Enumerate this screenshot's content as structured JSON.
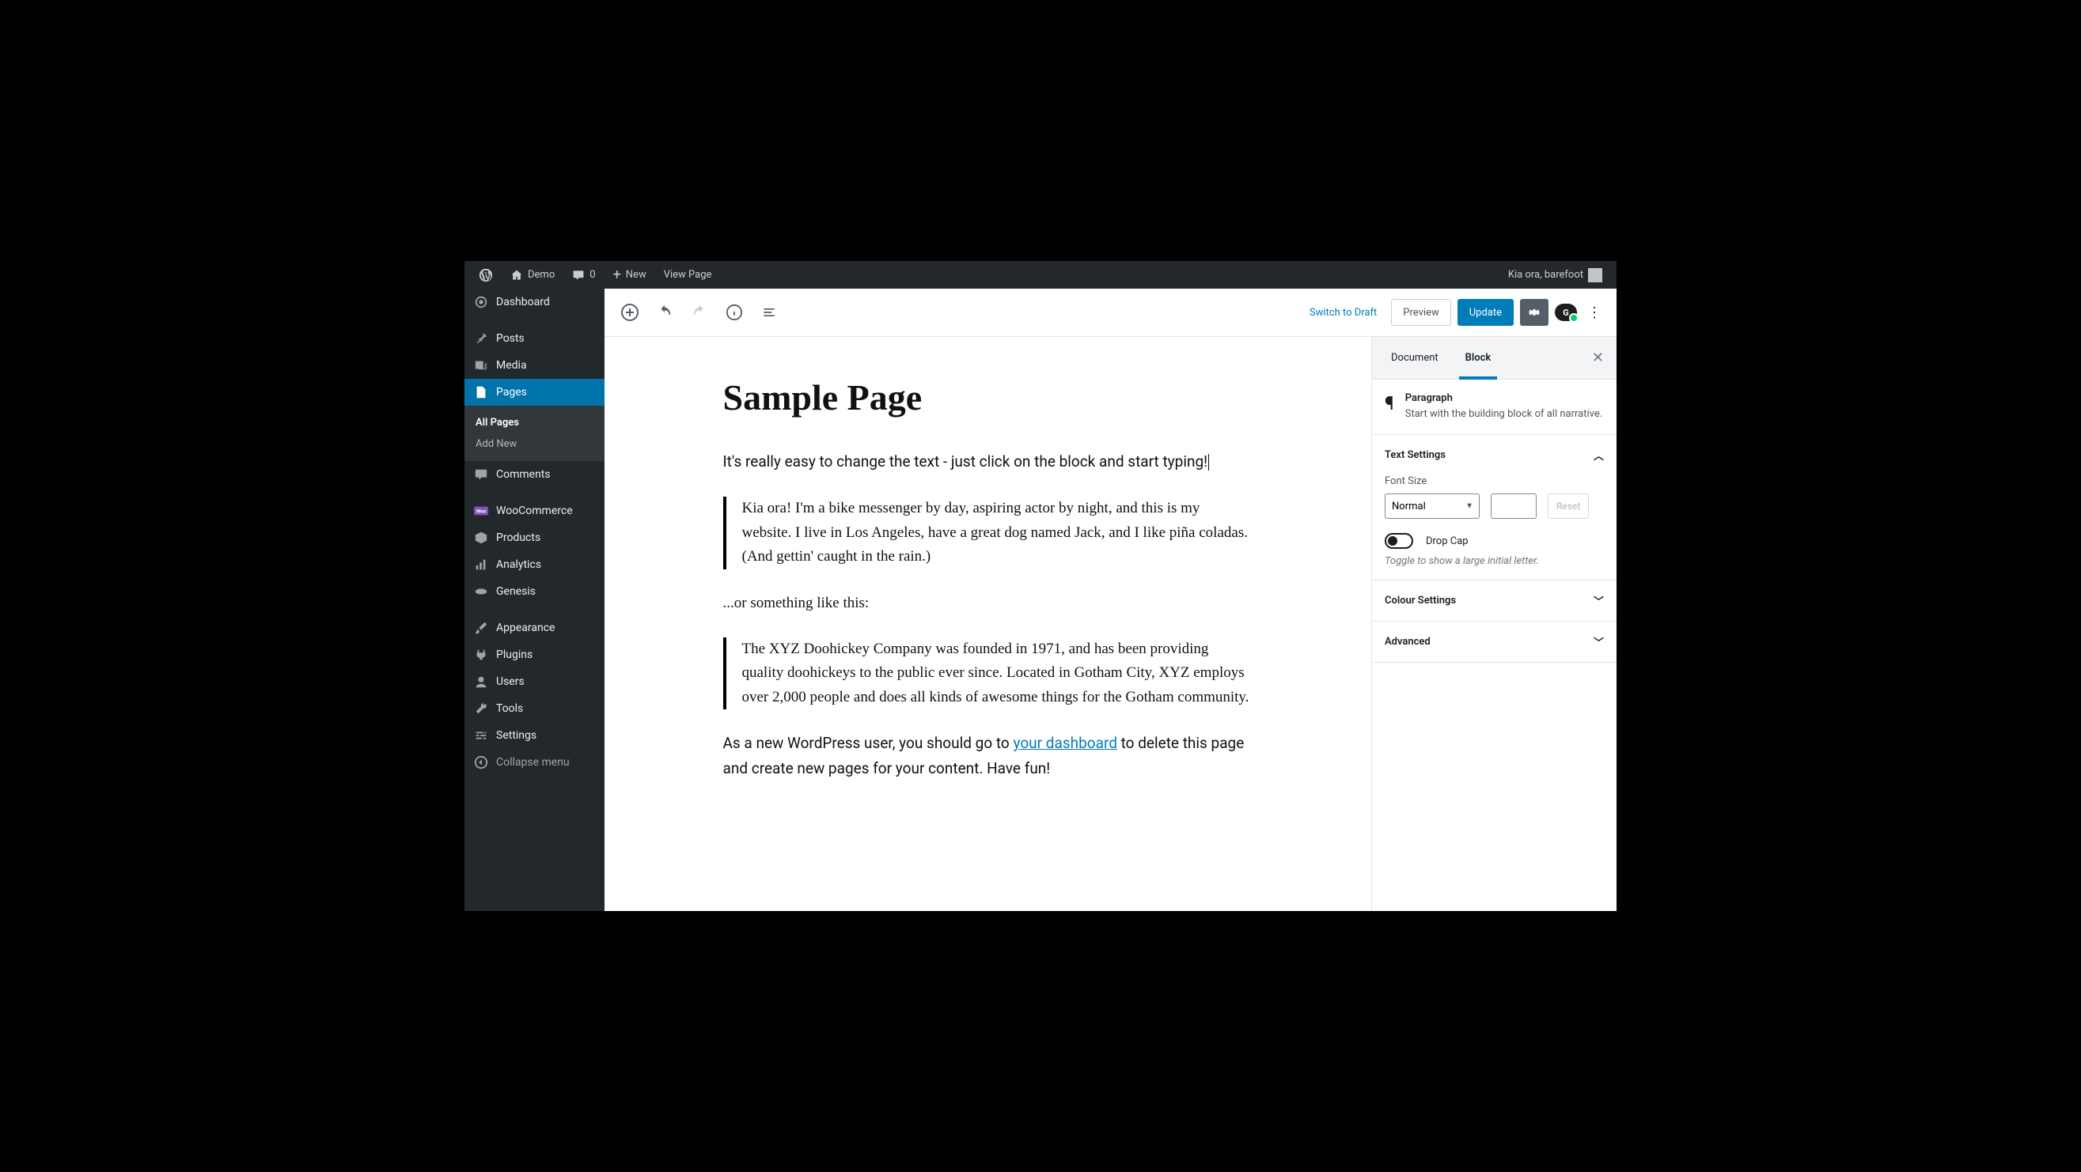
{
  "adminbar": {
    "site_name": "Demo",
    "comment_count": "0",
    "new_label": "New",
    "view_page": "View Page",
    "greeting": "Kia ora, barefoot"
  },
  "sidebar": {
    "dashboard": "Dashboard",
    "posts": "Posts",
    "media": "Media",
    "pages": "Pages",
    "pages_sub": {
      "all": "All Pages",
      "add": "Add New"
    },
    "comments": "Comments",
    "woocommerce": "WooCommerce",
    "products": "Products",
    "analytics": "Analytics",
    "genesis": "Genesis",
    "appearance": "Appearance",
    "plugins": "Plugins",
    "users": "Users",
    "tools": "Tools",
    "settings": "Settings",
    "collapse": "Collapse menu"
  },
  "toolbar": {
    "switch_draft": "Switch to Draft",
    "preview": "Preview",
    "update": "Update"
  },
  "content": {
    "title": "Sample Page",
    "p1": "It's really easy to change the text - just click on the block and start typing!",
    "q1": "Kia ora! I'm a bike messenger by day, aspiring actor by night, and this is my website. I live in Los Angeles, have a great dog named Jack, and I like piña coladas. (And gettin' caught in the rain.)",
    "p2": "...or something like this:",
    "q2": "The XYZ Doohickey Company was founded in 1971, and has been providing quality doohickeys to the public ever since. Located in Gotham City, XYZ employs over 2,000 people and does all kinds of awesome things for the Gotham community.",
    "p3_a": "As a new WordPress user, you should go to ",
    "p3_link": "your dashboard",
    "p3_b": " to delete this page and create new pages for your content. Have fun!"
  },
  "settings": {
    "tabs": {
      "document": "Document",
      "block": "Block"
    },
    "block_name": "Paragraph",
    "block_desc": "Start with the building block of all narrative.",
    "text_settings": "Text Settings",
    "font_size_label": "Font Size",
    "font_size_value": "Normal",
    "reset": "Reset",
    "drop_cap": "Drop Cap",
    "drop_cap_desc": "Toggle to show a large initial letter.",
    "colour_settings": "Colour Settings",
    "advanced": "Advanced"
  }
}
